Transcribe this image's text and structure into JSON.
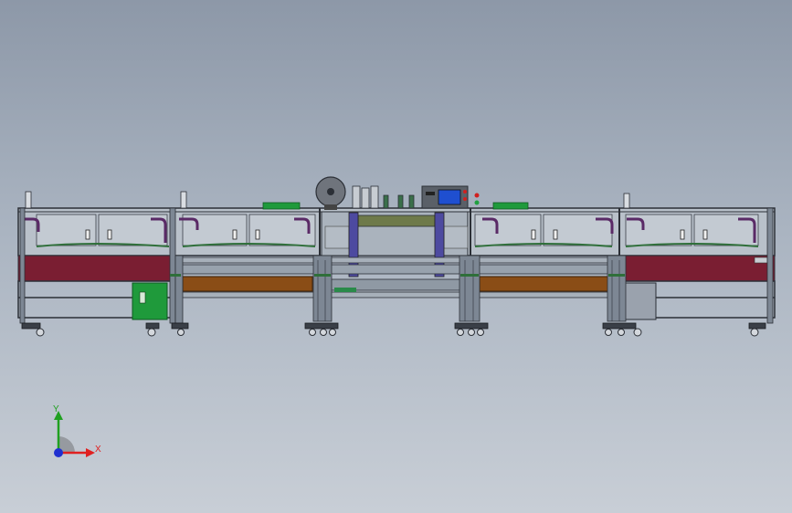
{
  "viewport": {
    "background_top": "#8d98a8",
    "background_bottom": "#c8ced6"
  },
  "model": {
    "name": "assembly-line-front-view",
    "colors": {
      "frame": "#2b2f36",
      "maroon_panel": "#7a1e32",
      "glass": "#b7bfc8",
      "purple_bracket": "#5a2a66",
      "conveyor_brown": "#8a4d16",
      "green_box": "#1f9a3b",
      "column_purple": "#4d4aa0",
      "hmi_screen": "#1f4fd0"
    }
  },
  "triad": {
    "x_label": "X",
    "y_label": "Y",
    "x_color": "#e02020",
    "y_color": "#20a020",
    "z_color": "#2030d0"
  }
}
